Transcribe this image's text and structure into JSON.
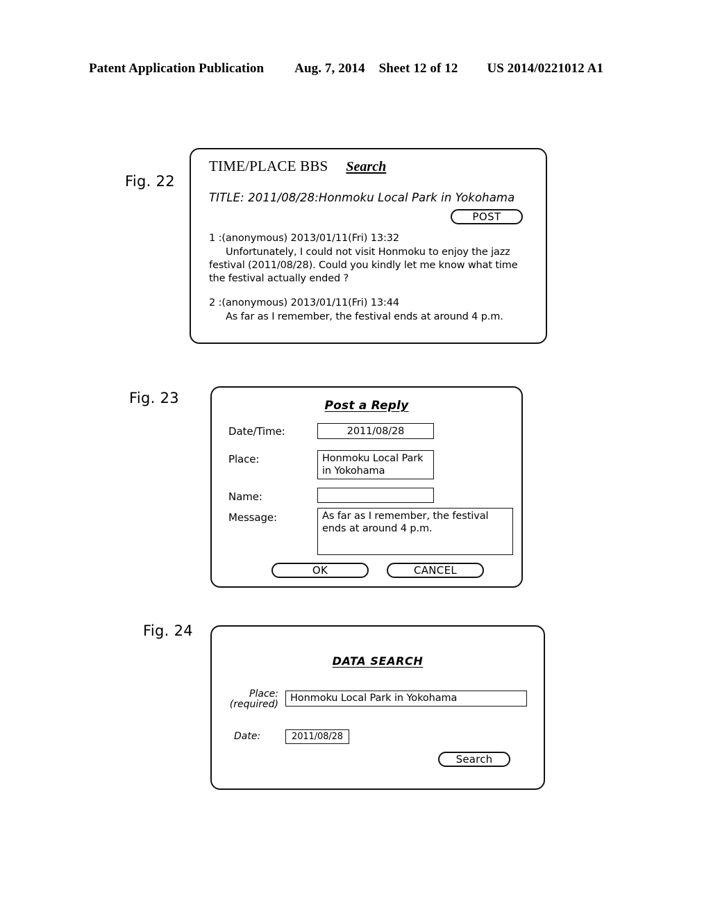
{
  "page_header": {
    "publication": "Patent Application Publication",
    "date": "Aug. 7, 2014",
    "sheet": "Sheet 12 of 12",
    "number": "US 2014/0221012 A1"
  },
  "figures": {
    "fig22": {
      "label": "Fig. 22",
      "bbs": {
        "title": "TIME/PLACE BBS",
        "search_link": "Search",
        "thread_title": "TITLE: 2011/08/28:Honmoku Local Park in Yokohama",
        "post_button": "POST",
        "posts": [
          {
            "header": "1 :(anonymous) 2013/01/11(Fri) 13:32",
            "body": "Unfortunately, I could not visit Honmoku to enjoy the jazz festival (2011/08/28). Could you kindly let me know what time the festival actually ended ?"
          },
          {
            "header": "2 :(anonymous) 2013/01/11(Fri) 13:44",
            "body": "As far as I remember, the festival ends at around 4 p.m."
          }
        ]
      }
    },
    "fig23": {
      "label": "Fig. 23",
      "reply_form": {
        "heading": "Post a Reply",
        "datetime_label": "Date/Time:",
        "datetime_value": "2011/08/28",
        "place_label": "Place:",
        "place_value": "Honmoku Local Park in Yokohama",
        "name_label": "Name:",
        "name_value": "",
        "message_label": "Message:",
        "message_value": "As far as I remember, the festival ends at around 4 p.m.",
        "ok_button": "OK",
        "cancel_button": "CANCEL"
      }
    },
    "fig24": {
      "label": "Fig. 24",
      "search_form": {
        "heading": "DATA SEARCH",
        "place_label": "Place:",
        "place_required_note": "(required)",
        "place_value": "Honmoku Local Park in Yokohama",
        "date_label": "Date:",
        "date_value": "2011/08/28",
        "search_button": "Search"
      }
    }
  },
  "colors": {
    "ink": "#000000",
    "paper": "#ffffff"
  }
}
